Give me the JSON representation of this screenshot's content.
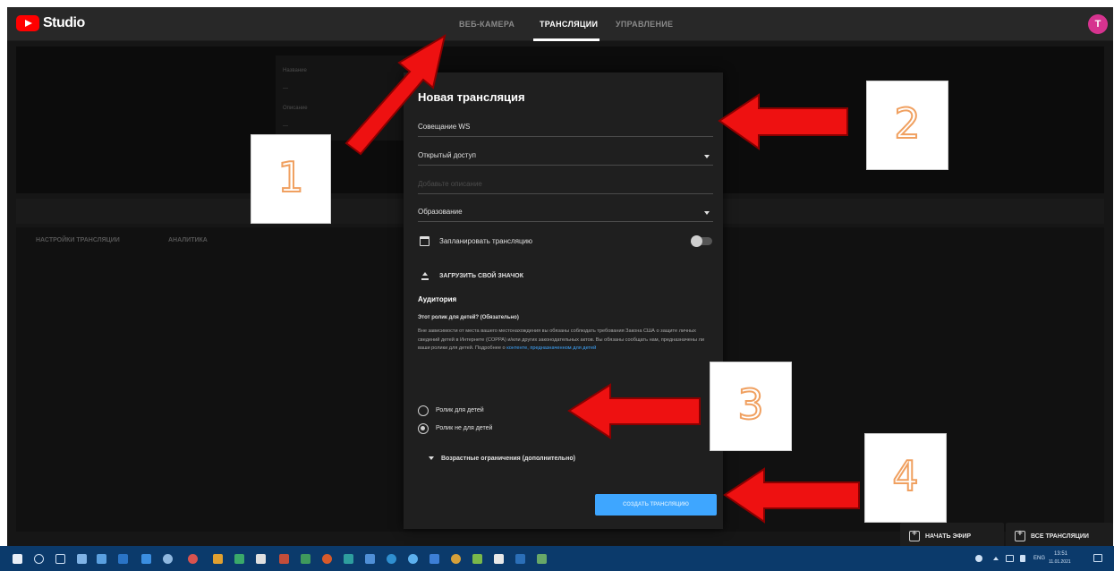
{
  "app": {
    "title": "Studio"
  },
  "top_tabs": [
    {
      "label": "ВЕБ-КАМЕРА",
      "active": false
    },
    {
      "label": "ТРАНСЛЯЦИИ",
      "active": true
    },
    {
      "label": "УПРАВЛЕНИЕ",
      "active": false
    }
  ],
  "user": {
    "avatar_letter": "T"
  },
  "background": {
    "meta": [
      "Название",
      "—",
      "Описание",
      "—"
    ],
    "sub_tabs": [
      "НАСТРОЙКИ ТРАНСЛЯЦИИ",
      "АНАЛИТИКА"
    ],
    "bottom_buttons": [
      "НАЧАТЬ ЭФИР",
      "ВСЕ ТРАНСЛЯЦИИ"
    ]
  },
  "dialog": {
    "title": "Новая трансляция",
    "name_value": "Совещание WS",
    "privacy_value": "Открытый доступ",
    "description_placeholder": "Добавьте описание",
    "category_value": "Образование",
    "schedule_label": "Запланировать трансляцию",
    "upload_thumbnail_label": "ЗАГРУЗИТЬ СВОЙ ЗНАЧОК",
    "audience_title": "Аудитория",
    "kids_question": "Этот ролик для детей? (Обязательно)",
    "kids_description": "Вне зависимости от места вашего местонахождения вы обязаны соблюдать требования Закона США о защите личных сведений детей в Интернете (COPPA) и/или других законодательных актов. Вы обязаны сообщать нам, предназначены ли ваши ролики для детей. Подробнее о",
    "kids_link": "контенте, предназначенном для детей",
    "radio_for_kids": "Ролик для детей",
    "radio_not_for_kids": "Ролик не для детей",
    "age_restrictions": "Возрастные ограничения (дополнительно)",
    "create_button": "СОЗДАТЬ ТРАНСЛЯЦИЮ"
  },
  "annotations": {
    "numbers": [
      "1",
      "2",
      "3",
      "4"
    ],
    "arrow_color": "#ee1111",
    "number_stroke_color": "#f0a060"
  },
  "taskbar": {
    "lang": "ENG",
    "time": "13:51",
    "date": "11.01.2021"
  }
}
